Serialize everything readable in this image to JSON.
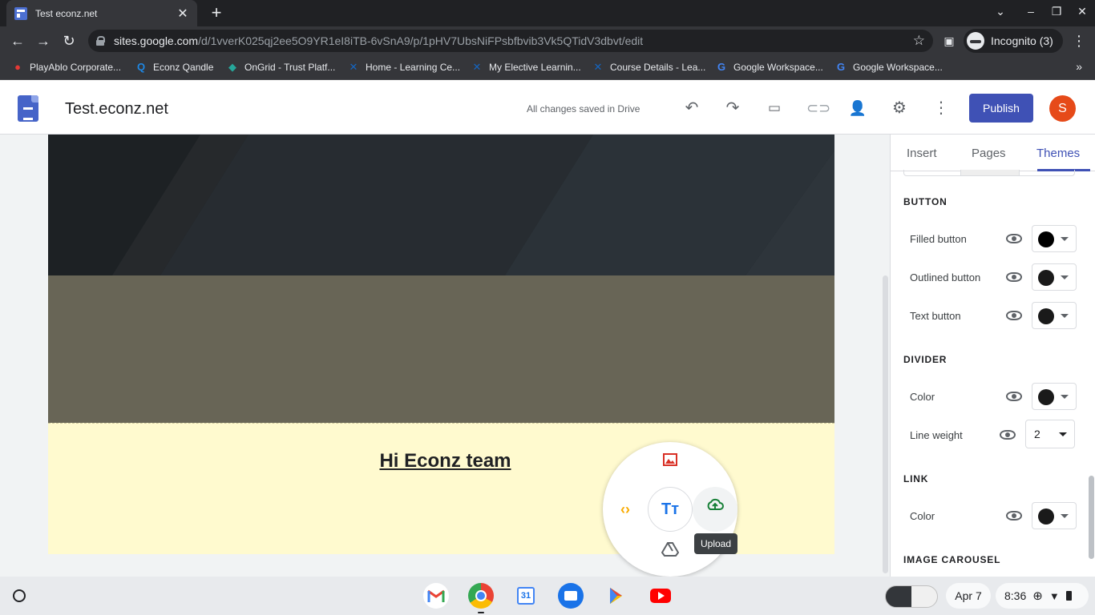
{
  "browser": {
    "tab_title": "Test econz.net",
    "url_host": "sites.google.com",
    "url_path": "/d/1vverK025qj2ee5O9YR1eI8iTB-6vSnA9/p/1pHV7UbsNiFPsbfbvib3Vk5QTidV3dbvt/edit",
    "incognito_label": "Incognito (3)",
    "bookmarks": [
      {
        "label": "PlayAblo Corporate...",
        "icon": "playablo-icon"
      },
      {
        "label": "Econz Qandle",
        "icon": "qandle-icon"
      },
      {
        "label": "OnGrid - Trust Platf...",
        "icon": "ongrid-icon"
      },
      {
        "label": "Home - Learning Ce...",
        "icon": "x-icon"
      },
      {
        "label": "My Elective Learnin...",
        "icon": "x-icon"
      },
      {
        "label": "Course Details - Lea...",
        "icon": "x-icon"
      },
      {
        "label": "Google Workspace...",
        "icon": "google-icon"
      },
      {
        "label": "Google Workspace...",
        "icon": "google-icon"
      }
    ]
  },
  "header": {
    "title": "Test.econz.net",
    "save_status": "All changes saved in Drive",
    "publish_label": "Publish",
    "avatar_letter": "S"
  },
  "canvas": {
    "heading": "Hi Econz team",
    "hero_color": "#22272b",
    "band_color": "#686556",
    "text_section_color": "#fffacf",
    "insert_menu": {
      "tooltip": "Upload",
      "items": [
        "image-icon",
        "embed-code-icon",
        "text-box-icon",
        "upload-icon",
        "drive-icon"
      ]
    }
  },
  "panel": {
    "tabs": [
      "Insert",
      "Pages",
      "Themes"
    ],
    "active_tab": "Themes",
    "sections": {
      "button": {
        "title": "BUTTON",
        "rows": [
          {
            "label": "Filled button",
            "color": "#000000"
          },
          {
            "label": "Outlined button",
            "color": "#1a1a1a"
          },
          {
            "label": "Text button",
            "color": "#1a1a1a"
          }
        ]
      },
      "divider": {
        "title": "DIVIDER",
        "color_label": "Color",
        "weight_label": "Line weight",
        "weight_value": "2"
      },
      "link": {
        "title": "LINK",
        "color_label": "Color"
      },
      "image_carousel": {
        "title": "IMAGE CAROUSEL"
      }
    }
  },
  "shelf": {
    "date": "Apr 7",
    "time": "8:36",
    "apps": [
      "gmail-icon",
      "chrome-icon",
      "calendar-icon",
      "files-icon",
      "play-store-icon",
      "youtube-icon"
    ],
    "calendar_day": "31"
  }
}
